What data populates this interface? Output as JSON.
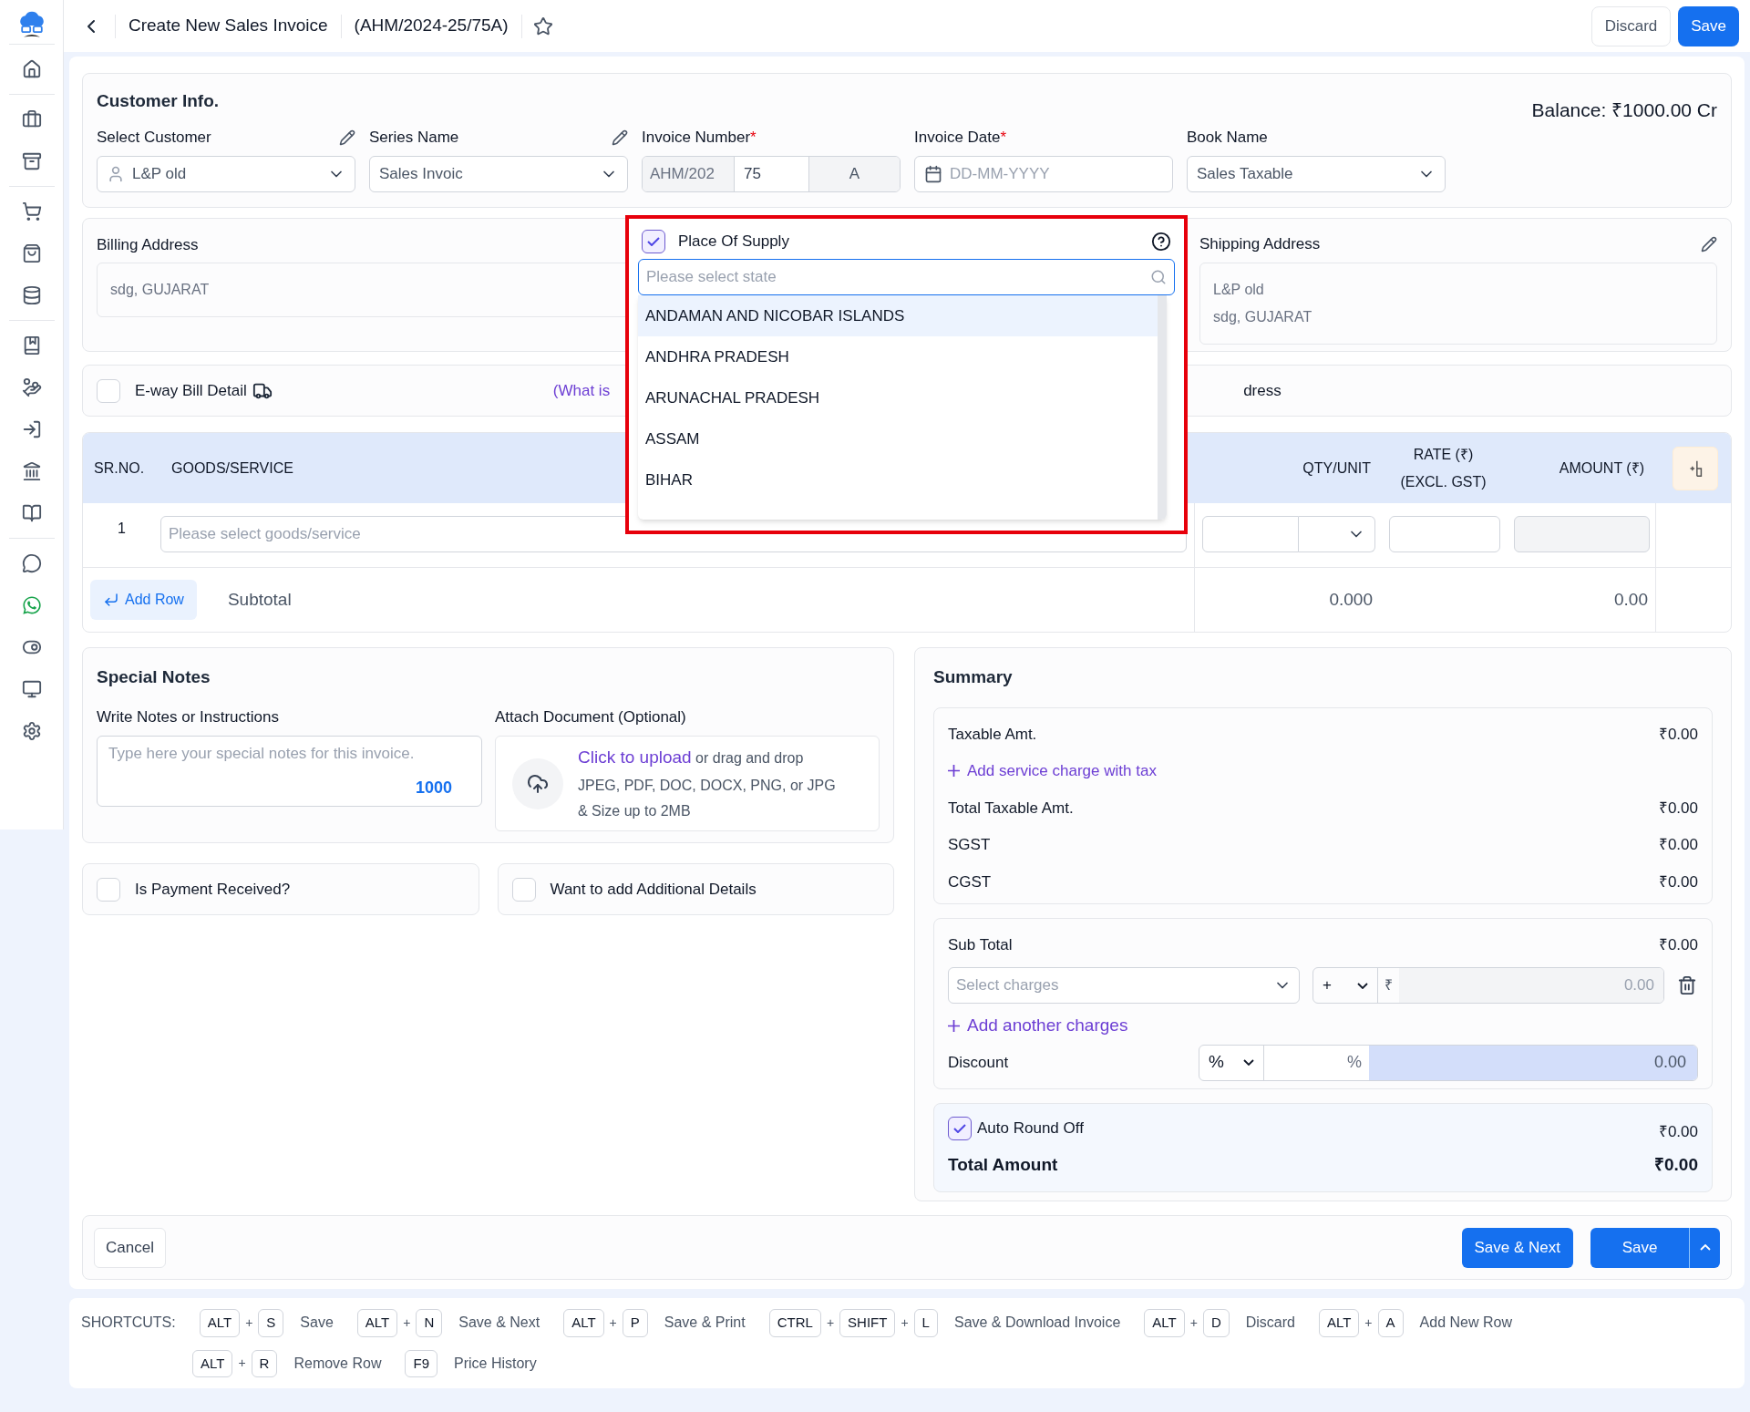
{
  "header": {
    "title": "Create New Sales Invoice",
    "invoice_code": "(AHM/2024-25/75A)",
    "favorite": false,
    "buttons": [
      {
        "label": "Discard",
        "kind": "secondary"
      },
      {
        "label": "Save",
        "kind": "primary"
      }
    ]
  },
  "customer_info": {
    "title": "Customer Info.",
    "balance": "Balance: ₹1000.00 Cr",
    "fields": [
      {
        "kind": "customer",
        "label": "Select Customer",
        "editable": true,
        "value": "L&P old"
      },
      {
        "kind": "select",
        "label": "Series Name",
        "editable": true,
        "value": "Sales Invoic"
      },
      {
        "kind": "number",
        "label": "Invoice Number",
        "required_mark": "*",
        "prefix": "AHM/202",
        "value": "75",
        "suffix": "A"
      },
      {
        "kind": "date",
        "label": "Invoice Date",
        "required_mark": "*",
        "placeholder": "DD-MM-YYYY"
      },
      {
        "kind": "select",
        "label": "Book Name",
        "value": "Sales Taxable"
      }
    ]
  },
  "addresses": {
    "billing": {
      "label": "Billing Address",
      "lines": [
        "sdg, GUJARAT"
      ]
    },
    "shipping": {
      "label": "Shipping Address",
      "editable": true,
      "lines": [
        "L&P old",
        "sdg, GUJARAT"
      ]
    }
  },
  "eway": {
    "checked": false,
    "label": "E-way Bill Detail",
    "link": "(What is",
    "trailing": "dress"
  },
  "place_of_supply": {
    "checked": true,
    "label": "Place Of Supply",
    "placeholder": "Please select state",
    "options": [
      {
        "label": "ANDAMAN AND NICOBAR ISLANDS",
        "selected": true
      },
      {
        "label": "ANDHRA PRADESH",
        "selected": false
      },
      {
        "label": "ARUNACHAL PRADESH",
        "selected": false
      },
      {
        "label": "ASSAM",
        "selected": false
      },
      {
        "label": "BIHAR",
        "selected": false
      }
    ]
  },
  "table": {
    "columns": [
      [
        "SR.NO."
      ],
      [
        "GOODS/SERVICE"
      ],
      [
        "QTY/UNIT"
      ],
      [
        "RATE (₹)",
        "(EXCL. GST)"
      ],
      [
        "AMOUNT (₹)"
      ]
    ],
    "rows": [
      {
        "sr": "1",
        "placeholder": "Please select goods/service"
      }
    ],
    "add_row": "Add Row",
    "subtotal_label": "Subtotal",
    "qty_total": "0.000",
    "amount_total": "0.00"
  },
  "notes": {
    "title": "Special Notes",
    "label": "Write Notes or Instructions",
    "placeholder": "Type here your special notes for this invoice.",
    "count": "1000",
    "attach_label": "Attach Document (Optional)",
    "upload_link": "Click to upload",
    "upload_text": "or drag and drop",
    "formats": "JPEG, PDF, DOC, DOCX, PNG, or JPG",
    "size": "& Size up to 2MB"
  },
  "options": [
    {
      "label": "Is Payment Received?",
      "checked": false
    },
    {
      "label": "Want to add Additional Details",
      "checked": false
    }
  ],
  "summary": {
    "title": "Summary",
    "taxable": {
      "label": "Taxable Amt.",
      "value": "₹0.00"
    },
    "service_link": "Add service charge with tax",
    "tax_rows": [
      {
        "label": "Total Taxable Amt.",
        "value": "₹0.00"
      },
      {
        "label": "SGST",
        "value": "₹0.00"
      },
      {
        "label": "CGST",
        "value": "₹0.00"
      }
    ],
    "subtotal": {
      "label": "Sub Total",
      "value": "₹0.00"
    },
    "charges": {
      "placeholder": "Select charges",
      "operator": "+",
      "currency": "₹",
      "amount": "0.00"
    },
    "add_charges": "Add another charges",
    "discount": {
      "label": "Discount",
      "unit": "%",
      "suffix": "%",
      "value": "0.00"
    },
    "round_off": {
      "checked": true,
      "label": "Auto Round Off",
      "value": "₹0.00"
    },
    "total": {
      "label": "Total Amount",
      "value": "₹0.00"
    }
  },
  "footer": {
    "cancel": "Cancel",
    "save_next": "Save & Next",
    "save": "Save"
  },
  "shortcuts": {
    "label": "SHORTCUTS:",
    "items": [
      {
        "sequence": [
          "ALT",
          "+",
          "S"
        ],
        "action": "Save"
      },
      {
        "sequence": [
          "ALT",
          "+",
          "N"
        ],
        "action": "Save & Next"
      },
      {
        "sequence": [
          "ALT",
          "+",
          "P"
        ],
        "action": "Save & Print"
      },
      {
        "sequence": [
          "CTRL",
          "+",
          "SHIFT",
          "+",
          "L"
        ],
        "action": "Save & Download Invoice"
      },
      {
        "sequence": [
          "ALT",
          "+",
          "D"
        ],
        "action": "Discard"
      },
      {
        "sequence": [
          "ALT",
          "+",
          "A"
        ],
        "action": "Add New Row"
      },
      {
        "sequence": [
          "ALT",
          "+",
          "R"
        ],
        "action": "Remove Row"
      },
      {
        "sequence": [
          "F9"
        ],
        "action": "Price History"
      }
    ]
  }
}
